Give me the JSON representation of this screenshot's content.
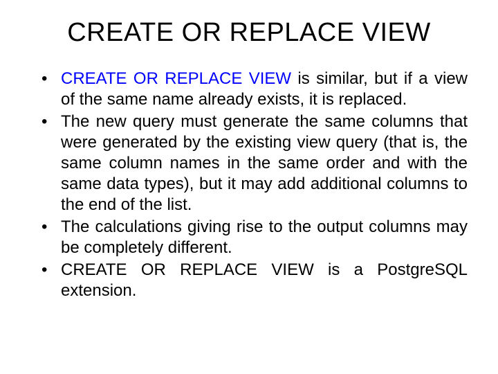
{
  "title": "CREATE OR REPLACE VIEW",
  "bullets": [
    {
      "keyword": "CREATE OR REPLACE VIEW",
      "rest": " is similar, but if a view of the same name already exists, it is replaced."
    },
    {
      "keyword": "",
      "rest": "The new query must generate the same columns that were generated by the existing view query (that is, the same column names in the same order and with the same data types), but it may add additional columns to the end of the list."
    },
    {
      "keyword": "",
      "rest": "The calculations giving rise to the output columns may be completely different."
    },
    {
      "keyword": "",
      "rest": "CREATE OR REPLACE VIEW is a PostgreSQL extension."
    }
  ]
}
